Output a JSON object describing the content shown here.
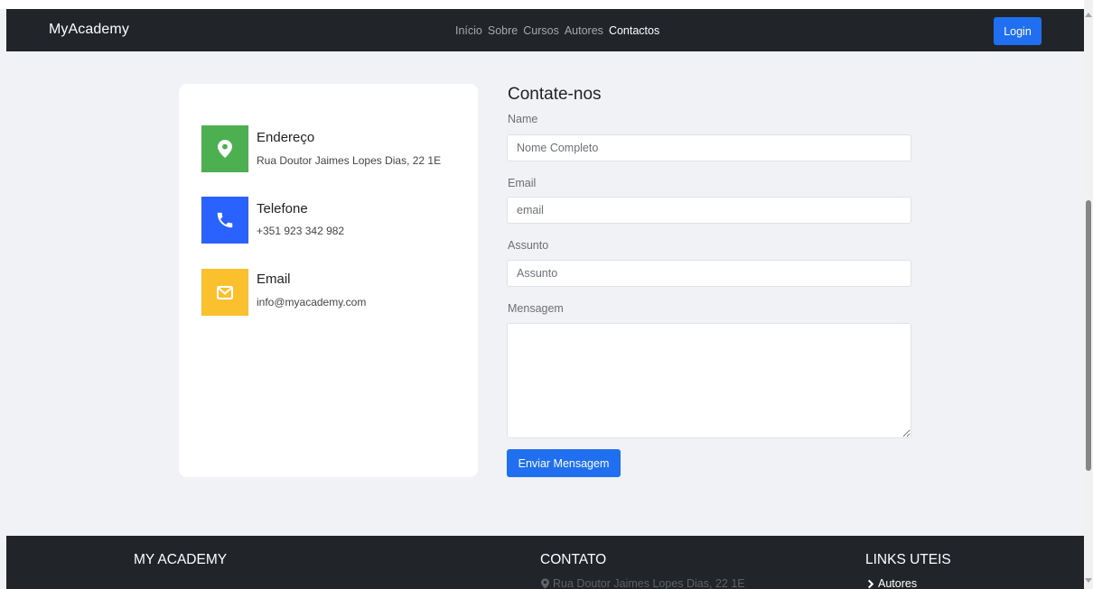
{
  "navbar": {
    "brand": "MyAcademy",
    "links": [
      "Início",
      "Sobre",
      "Cursos",
      "Autores",
      "Contactos"
    ],
    "active_link": "Contactos",
    "login_label": "Login"
  },
  "info_card": {
    "items": [
      {
        "title": "Endereço",
        "value": "Rua Doutor Jaimes Lopes Dias, 22 1E",
        "icon": "map-pin-icon",
        "color": "#4caf50"
      },
      {
        "title": "Telefone",
        "value": "+351 923 342 982",
        "icon": "phone-icon",
        "color": "#2962ff"
      },
      {
        "title": "Email",
        "value": "info@myacademy.com",
        "icon": "envelope-icon",
        "color": "#fbc02d"
      }
    ]
  },
  "contact_form": {
    "title": "Contate-nos",
    "fields": [
      {
        "label": "Name",
        "placeholder": "Nome Completo"
      },
      {
        "label": "Email",
        "placeholder": "email"
      },
      {
        "label": "Assunto",
        "placeholder": "Assunto"
      }
    ],
    "message_label": "Mensagem",
    "submit_label": "Enviar Mensagem"
  },
  "footer": {
    "brand_heading": "MY ACADEMY",
    "contact_heading": "CONTATO",
    "contact_address": "Rua Doutor Jaimes Lopes Dias, 22 1E",
    "links_heading": "LINKS UTEIS",
    "links": [
      "Autores"
    ]
  },
  "colors": {
    "navbar_bg": "#212529",
    "primary_button": "#1f6ff0",
    "page_bg": "#f0f2f5"
  }
}
